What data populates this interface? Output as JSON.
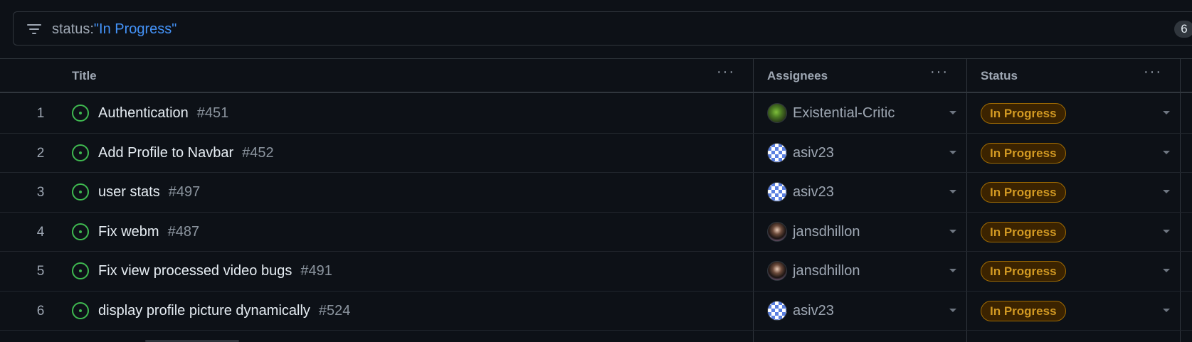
{
  "filter": {
    "key": "status:",
    "value": "\"In Progress\"",
    "count": "6"
  },
  "columns": {
    "title": "Title",
    "assignees": "Assignees",
    "status": "Status",
    "menu_glyph": "···"
  },
  "rows": [
    {
      "index": "1",
      "title": "Authentication",
      "number": "#451",
      "assignee": "Existential-Critic",
      "avatar": "green",
      "status": "In Progress"
    },
    {
      "index": "2",
      "title": "Add Profile to Navbar",
      "number": "#452",
      "assignee": "asiv23",
      "avatar": "blue",
      "status": "In Progress"
    },
    {
      "index": "3",
      "title": "user stats",
      "number": "#497",
      "assignee": "asiv23",
      "avatar": "blue",
      "status": "In Progress"
    },
    {
      "index": "4",
      "title": "Fix webm",
      "number": "#487",
      "assignee": "jansdhillon",
      "avatar": "dark",
      "status": "In Progress"
    },
    {
      "index": "5",
      "title": "Fix view processed video bugs",
      "number": "#491",
      "assignee": "jansdhillon",
      "avatar": "dark",
      "status": "In Progress"
    },
    {
      "index": "6",
      "title": "display profile picture dynamically",
      "number": "#524",
      "assignee": "asiv23",
      "avatar": "blue",
      "status": "In Progress"
    }
  ],
  "colors": {
    "background": "#0d1117",
    "open_issue": "#3fb950",
    "status_fg": "#d29922",
    "status_border": "#9e6a03",
    "filter_value": "#4493f8"
  }
}
